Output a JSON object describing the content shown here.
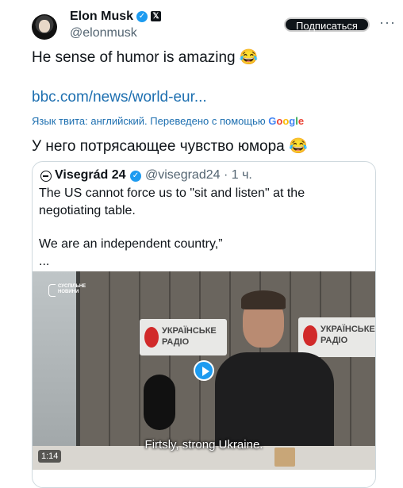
{
  "tweet": {
    "author_name": "Elon Musk",
    "author_handle": "@elonmusk",
    "subscribe_label": "Подписаться",
    "more_label": "···",
    "text": "He sense of humor is amazing 😂",
    "link": "bbc.com/news/world-eur...",
    "translation_note": "Язык твита: английский. Переведено с помощью",
    "translation_text": "У него потрясающее чувство юмора 😂"
  },
  "quote": {
    "author_name": "Visegrád 24",
    "author_handle": "@visegrad24 · 1 ч.",
    "line1": "The US cannot force us to \"sit and listen\" at the",
    "line2": "negotiating table.",
    "line3": "We are an independent country,”",
    "ellipsis": "...",
    "video": {
      "logo_line1": "СУСПІЛЬНЕ",
      "logo_line2": "НОВИНИ",
      "sign_line1": "УКРАЇНСЬКЕ",
      "sign_line2": "РАДІО",
      "subtitle": "Firtsly, strong Ukraine.",
      "duration": "1:14"
    }
  },
  "colors": {
    "verified": "#1d9bf0",
    "link": "#1d6fb0"
  }
}
